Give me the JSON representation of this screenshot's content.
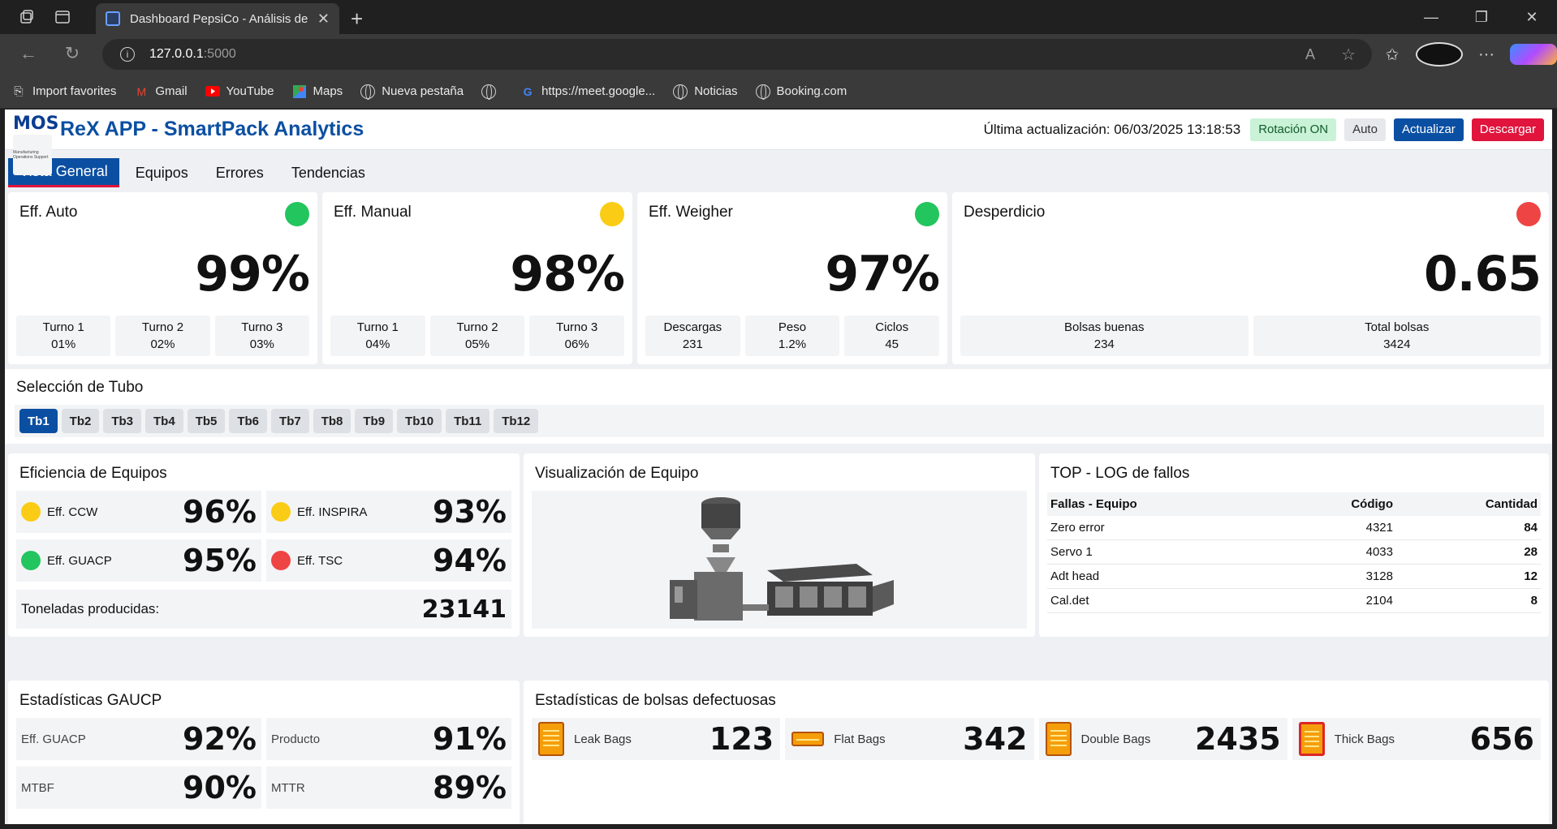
{
  "browser": {
    "tab_title": "Dashboard PepsiCo - Análisis de E",
    "url_host": "127.0.0.1",
    "url_port": ":5000",
    "bookmarks": [
      "Import favorites",
      "Gmail",
      "YouTube",
      "Maps",
      "Nueva pestaña",
      "",
      "https://meet.google...",
      "Noticias",
      "Booking.com"
    ]
  },
  "header": {
    "logo_text": "MOS",
    "logo_sub": "Manufacturing Operations Support",
    "title": "ReX APP - SmartPack Analytics",
    "last_update": "Última actualización: 06/03/2025 13:18:53",
    "rotation": "Rotación ON",
    "auto": "Auto",
    "update_btn": "Actualizar",
    "download_btn": "Descargar"
  },
  "tabs": [
    "Vista General",
    "Equipos",
    "Errores",
    "Tendencias"
  ],
  "kpis": [
    {
      "title": "Eff. Auto",
      "status": "green",
      "value": "99%",
      "subs": [
        {
          "l": "Turno 1",
          "v": "01%"
        },
        {
          "l": "Turno 2",
          "v": "02%"
        },
        {
          "l": "Turno 3",
          "v": "03%"
        }
      ]
    },
    {
      "title": "Eff. Manual",
      "status": "yellow",
      "value": "98%",
      "subs": [
        {
          "l": "Turno 1",
          "v": "04%"
        },
        {
          "l": "Turno 2",
          "v": "05%"
        },
        {
          "l": "Turno 3",
          "v": "06%"
        }
      ]
    },
    {
      "title": "Eff. Weigher",
      "status": "green",
      "value": "97%",
      "subs": [
        {
          "l": "Descargas",
          "v": "231"
        },
        {
          "l": "Peso",
          "v": "1.2%"
        },
        {
          "l": "Ciclos",
          "v": "45"
        }
      ]
    },
    {
      "title": "Desperdicio",
      "status": "red",
      "value": "0.65",
      "subs": [
        {
          "l": "Bolsas buenas",
          "v": "234"
        },
        {
          "l": "Total bolsas",
          "v": "3424"
        }
      ]
    }
  ],
  "tubes": {
    "title": "Selección de Tubo",
    "items": [
      "Tb1",
      "Tb2",
      "Tb3",
      "Tb4",
      "Tb5",
      "Tb6",
      "Tb7",
      "Tb8",
      "Tb9",
      "Tb10",
      "Tb11",
      "Tb12"
    ],
    "selected": "Tb1"
  },
  "equipment": {
    "title": "Eficiencia de Equipos",
    "rows": [
      [
        {
          "label": "Eff. CCW",
          "status": "yellow",
          "value": "96%"
        },
        {
          "label": "Eff. INSPIRA",
          "status": "yellow",
          "value": "93%"
        }
      ],
      [
        {
          "label": "Eff. GUACP",
          "status": "green",
          "value": "95%"
        },
        {
          "label": "Eff. TSC",
          "status": "red",
          "value": "94%"
        }
      ]
    ],
    "tons_label": "Toneladas producidas:",
    "tons_value": "23141"
  },
  "visualization": {
    "title": "Visualización de Equipo"
  },
  "log": {
    "title": "TOP - LOG de fallos",
    "headers": [
      "Fallas - Equipo",
      "Código",
      "Cantidad"
    ],
    "rows": [
      {
        "name": "Zero error",
        "code": "4321",
        "qty": "84"
      },
      {
        "name": "Servo 1",
        "code": "4033",
        "qty": "28"
      },
      {
        "name": "Adt head",
        "code": "3128",
        "qty": "12"
      },
      {
        "name": "Cal.det",
        "code": "2104",
        "qty": "8"
      }
    ]
  },
  "gaucp": {
    "title": "Estadísticas GAUCP",
    "rows": [
      [
        {
          "label": "Eff. GUACP",
          "value": "92%"
        },
        {
          "label": "Producto",
          "value": "91%"
        }
      ],
      [
        {
          "label": "MTBF",
          "value": "90%"
        },
        {
          "label": "MTTR",
          "value": "89%"
        }
      ]
    ]
  },
  "bags": {
    "title": "Estadísticas de bolsas defectuosas",
    "items": [
      {
        "label": "Leak Bags",
        "value": "123"
      },
      {
        "label": "Flat Bags",
        "value": "342"
      },
      {
        "label": "Double Bags",
        "value": "2435"
      },
      {
        "label": "Thick Bags",
        "value": "656"
      }
    ]
  },
  "colors": {
    "brand_blue": "#0b4fa2",
    "brand_red": "#e0143c",
    "ok": "#22c55e",
    "warn": "#facc15",
    "bad": "#ef4444"
  }
}
